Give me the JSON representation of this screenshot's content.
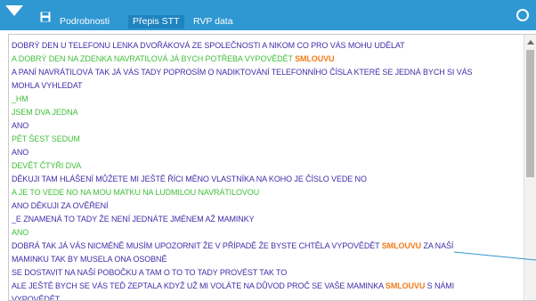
{
  "colors": {
    "toolbar_bg": "#2f97d1",
    "operator_text": "#3d2fa8",
    "customer_text": "#3fbf3a",
    "keyword": "#f07d1a"
  },
  "toolbar": {
    "menu_icon": "chevron-down-icon",
    "save_icon": "floppy-disk-icon",
    "tabs": [
      {
        "label": "Podrobnosti"
      },
      {
        "label": "Přepis STT"
      },
      {
        "label": "RVP data"
      }
    ]
  },
  "transcript": {
    "lines": [
      {
        "speaker": "operator",
        "text": "DOBRÝ DEN U TELEFONU LENKA DVOŘÁKOVÁ ZE SPOLEČNOSTI A NIKOM CO PRO VÁS MOHU UDĚLAT"
      },
      {
        "speaker": "customer",
        "before": "A DOBRÝ DEN NA ZDENKA NAVRATILOVÁ JÁ BYCH POTŘEBA VYPOVĚDĚT ",
        "keyword": "SMLOUVU",
        "after": ""
      },
      {
        "speaker": "operator",
        "text": "A PANÍ NAVRÁTILOVÁ TAK JÁ VÁS TADY POPROSÍM O NADIKTOVÁNÍ TELEFONNÍHO ČÍSLA KTERÉ SE JEDNÁ BYCH SI VÁS"
      },
      {
        "speaker": "operator",
        "text": "MOHLA VYHLEDAT"
      },
      {
        "speaker": "customer",
        "text": "_HM"
      },
      {
        "speaker": "customer",
        "text": "JSEM DVA JEDNA"
      },
      {
        "speaker": "operator",
        "text": "ANO"
      },
      {
        "speaker": "customer",
        "text": "PĚT ŠEST SEDUM"
      },
      {
        "speaker": "operator",
        "text": "ANO"
      },
      {
        "speaker": "customer",
        "text": "DEVĚT ČTYŘI DVA"
      },
      {
        "speaker": "operator",
        "text": "DĚKUJI TAM HLÁŠENÍ MŮŽETE MI JEŠTĚ ŘÍCI MĚNO VLASTNÍKA NA KOHO JE ČÍSLO VEDE NO"
      },
      {
        "speaker": "customer",
        "text": "A JE TO VEDE NO NA MOU MATKU NA LUDMILOU NAVRÁTILOVOU"
      },
      {
        "speaker": "operator",
        "text": "ANO DĚKUJI ZA OVĚŘENÍ"
      },
      {
        "speaker": "operator",
        "text": "_E ZNAMENÁ TO TADY ŽE NENÍ JEDNÁTE JMÉNEM AŽ MAMINKY"
      },
      {
        "speaker": "customer",
        "text": "ANO"
      },
      {
        "speaker": "operator",
        "before": "DOBRÁ TAK JÁ VÁS NICMÉNĚ MUSÍM UPOZORNIT ŽE V PŘÍPADĚ ŽE BYSTE CHTĚLA VYPOVĚDĚT ",
        "keyword": "SMLOUVU",
        "after": " ZA NAŠÍ"
      },
      {
        "speaker": "operator",
        "text": "MAMINKU TAK BY MUSELA ONA OSOBNĚ"
      },
      {
        "speaker": "operator",
        "text": "SE DOSTAVIT NA NAŠÍ POBOČKU A TAM O TO TO TADY PROVÉST TAK TO"
      },
      {
        "speaker": "operator",
        "before": "ALE JEŠTĚ BYCH SE VÁS TEĎ ZEPTALA KDYŽ UŽ MI VOLÁTE NA DŮVOD PROČ SE VAŠE MAMINKA ",
        "keyword": "SMLOUVU",
        "after": " S NÁMI"
      },
      {
        "speaker": "operator",
        "text": "VYPOVĚDĚT"
      }
    ]
  }
}
